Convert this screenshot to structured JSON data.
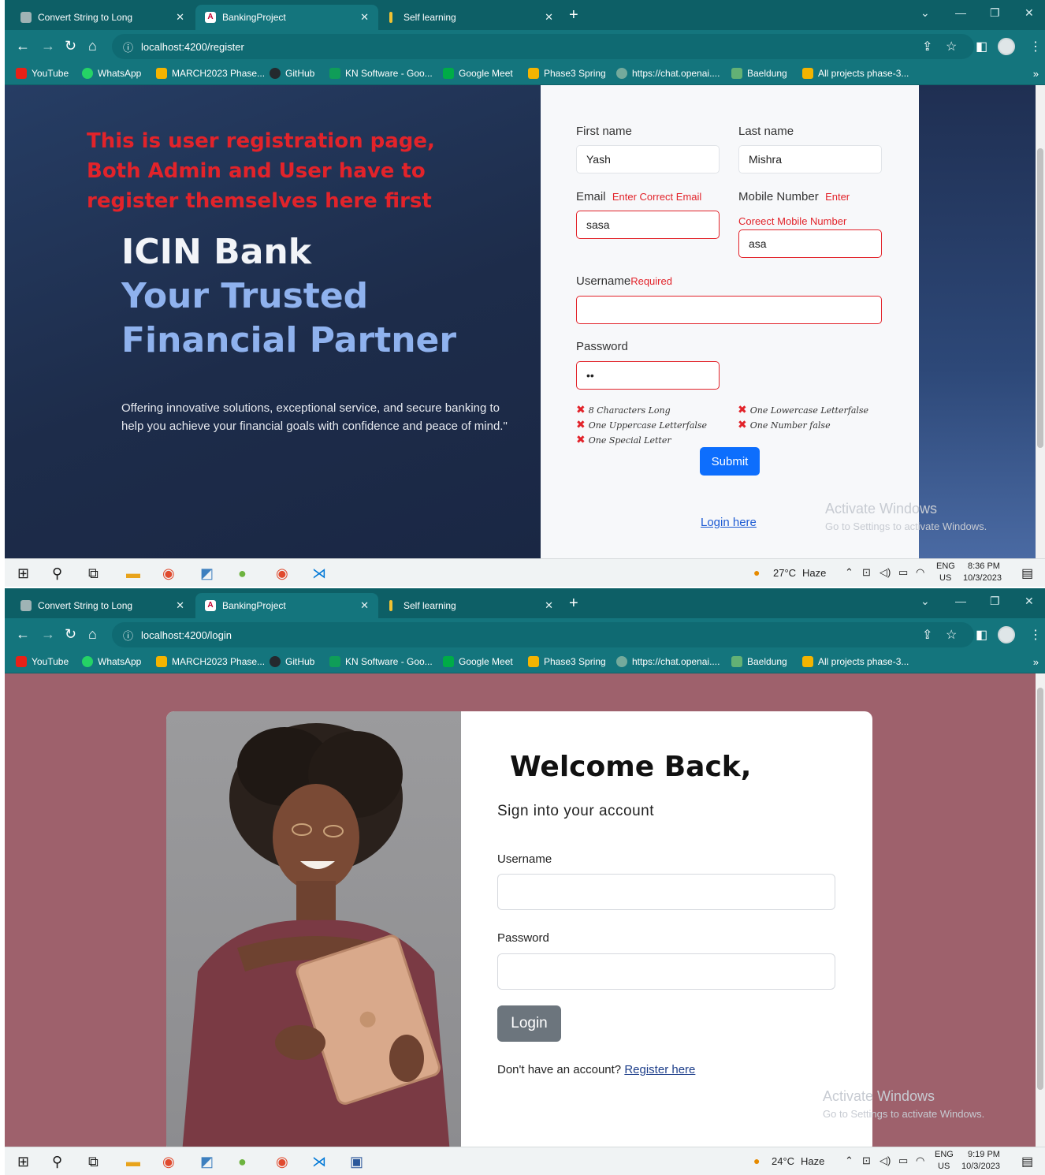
{
  "browser": {
    "tabs": [
      {
        "title": "Convert String to Long",
        "active": false
      },
      {
        "title": "BankingProject",
        "active": true
      },
      {
        "title": "Self learning",
        "active": false
      }
    ],
    "new_tab": "+",
    "bookmarks": [
      "YouTube",
      "WhatsApp",
      "MARCH2023 Phase...",
      "GitHub",
      "KN Software - Goo...",
      "Google Meet",
      "Phase3 Spring",
      "https://chat.openai....",
      "Baeldung",
      "All projects phase-3..."
    ],
    "overflow": "»"
  },
  "screen1": {
    "url": "localhost:4200/register",
    "left_panel": {
      "notice_line1": "This is user registration page,",
      "notice_line2": "Both Admin and User have to",
      "notice_line3": "register themselves here first",
      "bank_name": "ICIN Bank",
      "tagline": "Your Trusted Financial Partner",
      "description": "Offering innovative solutions, exceptional service, and secure banking to help you achieve your financial goals with confidence and peace of mind.\""
    },
    "form": {
      "first_name_label": "First name",
      "first_name_value": "Yash",
      "last_name_label": "Last name",
      "last_name_value": "Mishra",
      "email_label": "Email",
      "email_error": "Enter Correct Email",
      "email_value": "sasa",
      "mobile_label": "Mobile Number",
      "mobile_error_1": "Enter",
      "mobile_error_2": "Coreect Mobile Number",
      "mobile_value": "asa",
      "username_label": "Username",
      "username_error": "Required",
      "username_value": "",
      "password_label": "Password",
      "password_value": "••",
      "rules": [
        "8 Characters Long",
        "One Lowercase Letterfalse",
        "One Uppercase Letterfalse",
        "One Number false",
        "One Special Letter"
      ],
      "rule_mark": "✖",
      "submit_label": "Submit",
      "login_link": "Login here"
    },
    "watermark": {
      "line1": "Activate Windows",
      "line2": "Go to Settings to activate Windows."
    },
    "taskbar": {
      "weather_temp": "27°C",
      "weather_text": "Haze",
      "lang": "ENG",
      "region": "US",
      "time": "8:36 PM",
      "date": "10/3/2023"
    }
  },
  "screen2": {
    "url": "localhost:4200/login",
    "heading": "Welcome Back,",
    "subheading": "Sign into your account",
    "username_label": "Username",
    "password_label": "Password",
    "login_button": "Login",
    "no_account_text": "Don't have an account?",
    "register_link": "Register here",
    "watermark": {
      "line1": "Activate Windows",
      "line2": "Go to Settings to activate Windows."
    },
    "taskbar": {
      "weather_temp": "24°C",
      "weather_text": "Haze",
      "lang": "ENG",
      "region": "US",
      "time": "9:19 PM",
      "date": "10/3/2023"
    }
  },
  "colors": {
    "chrome_teal": "#14757d",
    "error_red": "#e2232a",
    "submit_blue": "#0d6efd",
    "login_bg": "#9e616c",
    "login_button": "#6c757d"
  }
}
